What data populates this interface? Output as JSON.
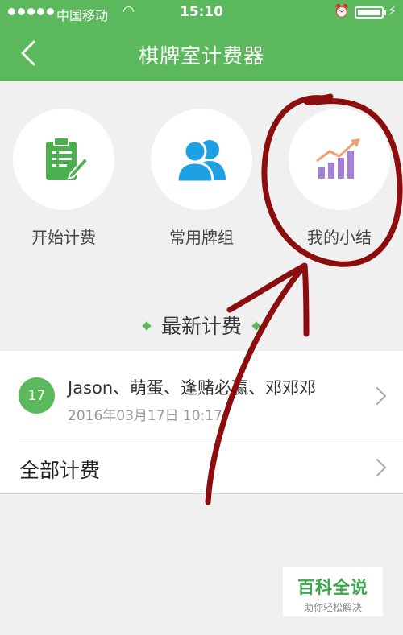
{
  "status_bar": {
    "carrier": "中国移动",
    "time": "15:10",
    "icons": [
      "signal-dots-icon",
      "wifi-icon",
      "alarm-icon",
      "battery-icon",
      "charging-icon"
    ]
  },
  "nav": {
    "title": "棋牌室计费器",
    "back_icon": "chevron-left-icon"
  },
  "features": [
    {
      "label": "开始计费",
      "icon": "clipboard-pen-icon",
      "color": "#4caf50"
    },
    {
      "label": "常用牌组",
      "icon": "users-icon",
      "color": "#1ea1e3"
    },
    {
      "label": "我的小结",
      "icon": "bar-chart-trend-icon",
      "color": "#a57fd8"
    }
  ],
  "section": {
    "title": "最新计费"
  },
  "records": [
    {
      "day": "17",
      "names": "Jason、萌蛋、逢赌必赢、邓邓邓",
      "date": "2016年03月17日  10:17"
    }
  ],
  "all_records_label": "全部计费",
  "watermark": {
    "main": "百科全说",
    "sub": "助你轻松解决"
  },
  "colors": {
    "primary": "#5cb85c",
    "annotation": "#8b0d0d"
  }
}
